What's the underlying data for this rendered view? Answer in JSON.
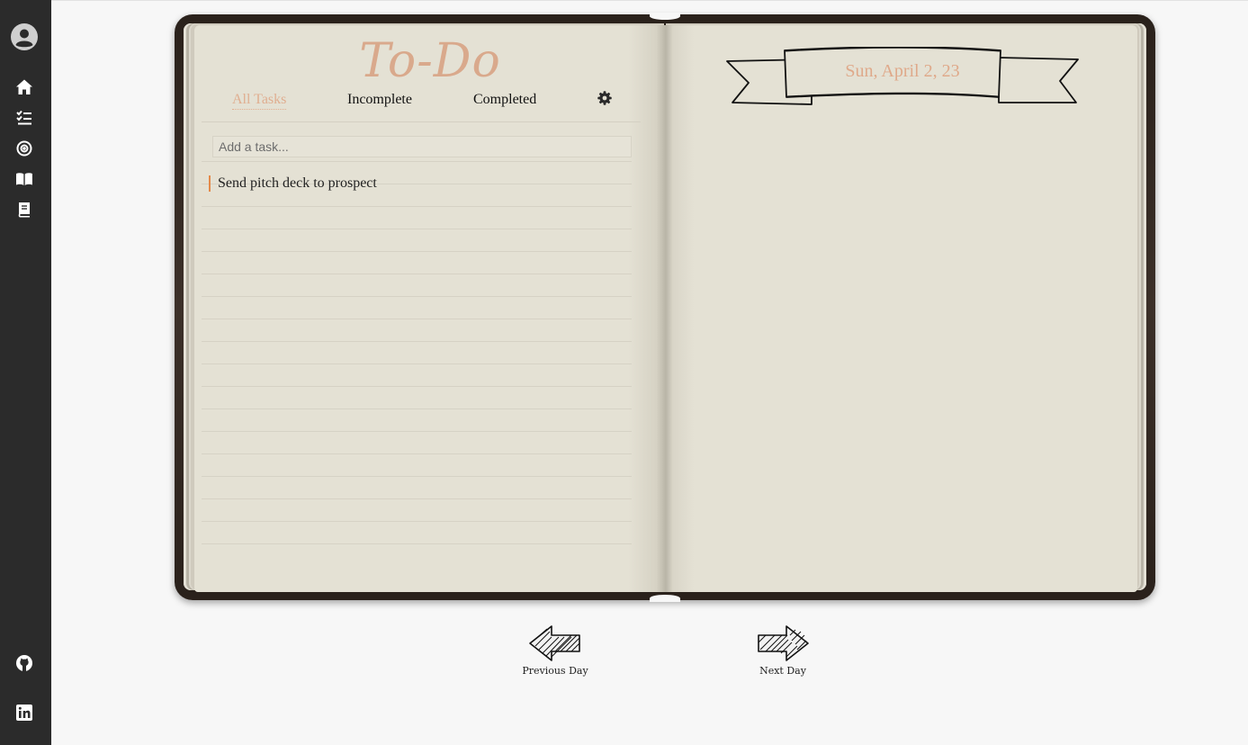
{
  "sidebar": {
    "items": [
      {
        "name": "profile",
        "icon": "user-icon"
      },
      {
        "name": "home",
        "icon": "home-icon"
      },
      {
        "name": "todo",
        "icon": "checklist-icon"
      },
      {
        "name": "goals",
        "icon": "target-icon"
      },
      {
        "name": "journal",
        "icon": "open-book-icon"
      },
      {
        "name": "notes",
        "icon": "book-icon"
      }
    ],
    "footer": [
      {
        "name": "github",
        "icon": "github-icon"
      },
      {
        "name": "linkedin",
        "icon": "linkedin-icon"
      }
    ]
  },
  "todo": {
    "title": "To-Do",
    "tabs": [
      {
        "label": "All Tasks",
        "active": true
      },
      {
        "label": "Incomplete",
        "active": false
      },
      {
        "label": "Completed",
        "active": false
      }
    ],
    "settings_icon": "gear-icon",
    "input_placeholder": "Add a task...",
    "input_value": "",
    "tasks": [
      {
        "text": "Send pitch deck to prospect",
        "completed": false
      }
    ]
  },
  "date_page": {
    "date": "Sun, April 2, 23"
  },
  "navigation": {
    "previous_label": "Previous Day",
    "next_label": "Next Day"
  },
  "colors": {
    "accent": "#d9a98c",
    "sidebar": "#2b2b2b",
    "cover": "#2f251f",
    "paper": "#e4e1d4",
    "task_marker": "#e48a4a"
  }
}
